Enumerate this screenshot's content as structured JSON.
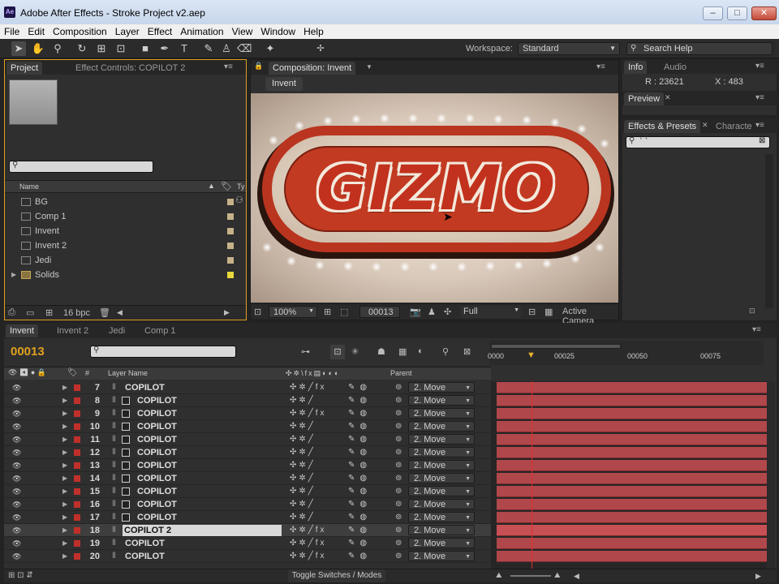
{
  "window": {
    "app_icon": "Ae",
    "title": "Adobe After Effects - Stroke Project v2.aep",
    "controls": [
      "‒",
      "□",
      "✕"
    ]
  },
  "menu": [
    "File",
    "Edit",
    "Composition",
    "Layer",
    "Effect",
    "Animation",
    "View",
    "Window",
    "Help"
  ],
  "toolbar": {
    "workspace_label": "Workspace:",
    "workspace_value": "Standard",
    "search_placeholder": "Search Help"
  },
  "project_panel": {
    "tabs": [
      "Project",
      "Effect Controls: COPILOT 2"
    ],
    "col_name": "Name",
    "col_type": "Ty",
    "items": [
      {
        "name": "BG"
      },
      {
        "name": "Comp 1"
      },
      {
        "name": "Invent"
      },
      {
        "name": "Invent 2"
      },
      {
        "name": "Jedi"
      },
      {
        "name": "Solids"
      }
    ],
    "bpc": "16 bpc"
  },
  "comp_panel": {
    "tab": "Composition: Invent",
    "breadcrumb": "Invent",
    "sign_text": "GIZMO",
    "zoom": "100%",
    "timecode": "00013",
    "resolution": "Full",
    "camera": "Active Camera"
  },
  "info_panel": {
    "tabs": [
      "Info",
      "Audio"
    ],
    "r": "R : 23621",
    "x": "X : 483"
  },
  "preview_panel": {
    "tab": "Preview"
  },
  "effects_panel": {
    "tabs": [
      "Effects & Presets",
      "Characte"
    ],
    "search_value": "` `"
  },
  "timeline": {
    "tabs": [
      "Invent",
      "Invent 2",
      "Jedi",
      "Comp 1"
    ],
    "timecode": "00013",
    "col_num": "#",
    "col_layer": "Layer Name",
    "col_parent": "Parent",
    "ruler": [
      "0000",
      "00025",
      "00050",
      "00075"
    ],
    "layers": [
      {
        "num": "7",
        "name": "COPILOT",
        "comp": false,
        "fx": true
      },
      {
        "num": "8",
        "name": "COPILOT",
        "comp": true,
        "fx": false
      },
      {
        "num": "9",
        "name": "COPILOT",
        "comp": true,
        "fx": true
      },
      {
        "num": "10",
        "name": "COPILOT",
        "comp": true,
        "fx": false
      },
      {
        "num": "11",
        "name": "COPILOT",
        "comp": true,
        "fx": false
      },
      {
        "num": "12",
        "name": "COPILOT",
        "comp": true,
        "fx": false
      },
      {
        "num": "13",
        "name": "COPILOT",
        "comp": true,
        "fx": false
      },
      {
        "num": "14",
        "name": "COPILOT",
        "comp": true,
        "fx": false
      },
      {
        "num": "15",
        "name": "COPILOT",
        "comp": true,
        "fx": false
      },
      {
        "num": "16",
        "name": "COPILOT",
        "comp": true,
        "fx": false
      },
      {
        "num": "17",
        "name": "COPILOT",
        "comp": true,
        "fx": false
      },
      {
        "num": "18",
        "name": "COPILOT 2",
        "comp": false,
        "fx": true,
        "selected": true
      },
      {
        "num": "19",
        "name": "COPILOT",
        "comp": false,
        "fx": true
      },
      {
        "num": "20",
        "name": "COPILOT",
        "comp": false,
        "fx": true
      }
    ],
    "parent_value": "2. Move",
    "toggle_label": "Toggle Switches / Modes"
  },
  "colors": {
    "accent_timecode": "#e0a020",
    "layer_bar": "#b0474b",
    "label_red": "#c0302a",
    "cti": "#e8b030"
  }
}
